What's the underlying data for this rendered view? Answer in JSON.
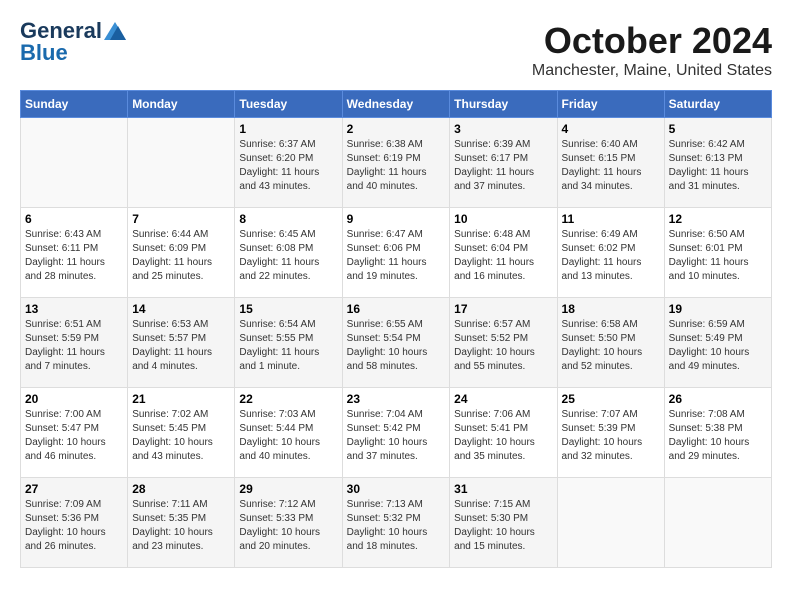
{
  "header": {
    "logo_general": "General",
    "logo_blue": "Blue",
    "month_title": "October 2024",
    "location": "Manchester, Maine, United States"
  },
  "weekdays": [
    "Sunday",
    "Monday",
    "Tuesday",
    "Wednesday",
    "Thursday",
    "Friday",
    "Saturday"
  ],
  "weeks": [
    [
      {
        "day": "",
        "sunrise": "",
        "sunset": "",
        "daylight": ""
      },
      {
        "day": "",
        "sunrise": "",
        "sunset": "",
        "daylight": ""
      },
      {
        "day": "1",
        "sunrise": "Sunrise: 6:37 AM",
        "sunset": "Sunset: 6:20 PM",
        "daylight": "Daylight: 11 hours and 43 minutes."
      },
      {
        "day": "2",
        "sunrise": "Sunrise: 6:38 AM",
        "sunset": "Sunset: 6:19 PM",
        "daylight": "Daylight: 11 hours and 40 minutes."
      },
      {
        "day": "3",
        "sunrise": "Sunrise: 6:39 AM",
        "sunset": "Sunset: 6:17 PM",
        "daylight": "Daylight: 11 hours and 37 minutes."
      },
      {
        "day": "4",
        "sunrise": "Sunrise: 6:40 AM",
        "sunset": "Sunset: 6:15 PM",
        "daylight": "Daylight: 11 hours and 34 minutes."
      },
      {
        "day": "5",
        "sunrise": "Sunrise: 6:42 AM",
        "sunset": "Sunset: 6:13 PM",
        "daylight": "Daylight: 11 hours and 31 minutes."
      }
    ],
    [
      {
        "day": "6",
        "sunrise": "Sunrise: 6:43 AM",
        "sunset": "Sunset: 6:11 PM",
        "daylight": "Daylight: 11 hours and 28 minutes."
      },
      {
        "day": "7",
        "sunrise": "Sunrise: 6:44 AM",
        "sunset": "Sunset: 6:09 PM",
        "daylight": "Daylight: 11 hours and 25 minutes."
      },
      {
        "day": "8",
        "sunrise": "Sunrise: 6:45 AM",
        "sunset": "Sunset: 6:08 PM",
        "daylight": "Daylight: 11 hours and 22 minutes."
      },
      {
        "day": "9",
        "sunrise": "Sunrise: 6:47 AM",
        "sunset": "Sunset: 6:06 PM",
        "daylight": "Daylight: 11 hours and 19 minutes."
      },
      {
        "day": "10",
        "sunrise": "Sunrise: 6:48 AM",
        "sunset": "Sunset: 6:04 PM",
        "daylight": "Daylight: 11 hours and 16 minutes."
      },
      {
        "day": "11",
        "sunrise": "Sunrise: 6:49 AM",
        "sunset": "Sunset: 6:02 PM",
        "daylight": "Daylight: 11 hours and 13 minutes."
      },
      {
        "day": "12",
        "sunrise": "Sunrise: 6:50 AM",
        "sunset": "Sunset: 6:01 PM",
        "daylight": "Daylight: 11 hours and 10 minutes."
      }
    ],
    [
      {
        "day": "13",
        "sunrise": "Sunrise: 6:51 AM",
        "sunset": "Sunset: 5:59 PM",
        "daylight": "Daylight: 11 hours and 7 minutes."
      },
      {
        "day": "14",
        "sunrise": "Sunrise: 6:53 AM",
        "sunset": "Sunset: 5:57 PM",
        "daylight": "Daylight: 11 hours and 4 minutes."
      },
      {
        "day": "15",
        "sunrise": "Sunrise: 6:54 AM",
        "sunset": "Sunset: 5:55 PM",
        "daylight": "Daylight: 11 hours and 1 minute."
      },
      {
        "day": "16",
        "sunrise": "Sunrise: 6:55 AM",
        "sunset": "Sunset: 5:54 PM",
        "daylight": "Daylight: 10 hours and 58 minutes."
      },
      {
        "day": "17",
        "sunrise": "Sunrise: 6:57 AM",
        "sunset": "Sunset: 5:52 PM",
        "daylight": "Daylight: 10 hours and 55 minutes."
      },
      {
        "day": "18",
        "sunrise": "Sunrise: 6:58 AM",
        "sunset": "Sunset: 5:50 PM",
        "daylight": "Daylight: 10 hours and 52 minutes."
      },
      {
        "day": "19",
        "sunrise": "Sunrise: 6:59 AM",
        "sunset": "Sunset: 5:49 PM",
        "daylight": "Daylight: 10 hours and 49 minutes."
      }
    ],
    [
      {
        "day": "20",
        "sunrise": "Sunrise: 7:00 AM",
        "sunset": "Sunset: 5:47 PM",
        "daylight": "Daylight: 10 hours and 46 minutes."
      },
      {
        "day": "21",
        "sunrise": "Sunrise: 7:02 AM",
        "sunset": "Sunset: 5:45 PM",
        "daylight": "Daylight: 10 hours and 43 minutes."
      },
      {
        "day": "22",
        "sunrise": "Sunrise: 7:03 AM",
        "sunset": "Sunset: 5:44 PM",
        "daylight": "Daylight: 10 hours and 40 minutes."
      },
      {
        "day": "23",
        "sunrise": "Sunrise: 7:04 AM",
        "sunset": "Sunset: 5:42 PM",
        "daylight": "Daylight: 10 hours and 37 minutes."
      },
      {
        "day": "24",
        "sunrise": "Sunrise: 7:06 AM",
        "sunset": "Sunset: 5:41 PM",
        "daylight": "Daylight: 10 hours and 35 minutes."
      },
      {
        "day": "25",
        "sunrise": "Sunrise: 7:07 AM",
        "sunset": "Sunset: 5:39 PM",
        "daylight": "Daylight: 10 hours and 32 minutes."
      },
      {
        "day": "26",
        "sunrise": "Sunrise: 7:08 AM",
        "sunset": "Sunset: 5:38 PM",
        "daylight": "Daylight: 10 hours and 29 minutes."
      }
    ],
    [
      {
        "day": "27",
        "sunrise": "Sunrise: 7:09 AM",
        "sunset": "Sunset: 5:36 PM",
        "daylight": "Daylight: 10 hours and 26 minutes."
      },
      {
        "day": "28",
        "sunrise": "Sunrise: 7:11 AM",
        "sunset": "Sunset: 5:35 PM",
        "daylight": "Daylight: 10 hours and 23 minutes."
      },
      {
        "day": "29",
        "sunrise": "Sunrise: 7:12 AM",
        "sunset": "Sunset: 5:33 PM",
        "daylight": "Daylight: 10 hours and 20 minutes."
      },
      {
        "day": "30",
        "sunrise": "Sunrise: 7:13 AM",
        "sunset": "Sunset: 5:32 PM",
        "daylight": "Daylight: 10 hours and 18 minutes."
      },
      {
        "day": "31",
        "sunrise": "Sunrise: 7:15 AM",
        "sunset": "Sunset: 5:30 PM",
        "daylight": "Daylight: 10 hours and 15 minutes."
      },
      {
        "day": "",
        "sunrise": "",
        "sunset": "",
        "daylight": ""
      },
      {
        "day": "",
        "sunrise": "",
        "sunset": "",
        "daylight": ""
      }
    ]
  ]
}
